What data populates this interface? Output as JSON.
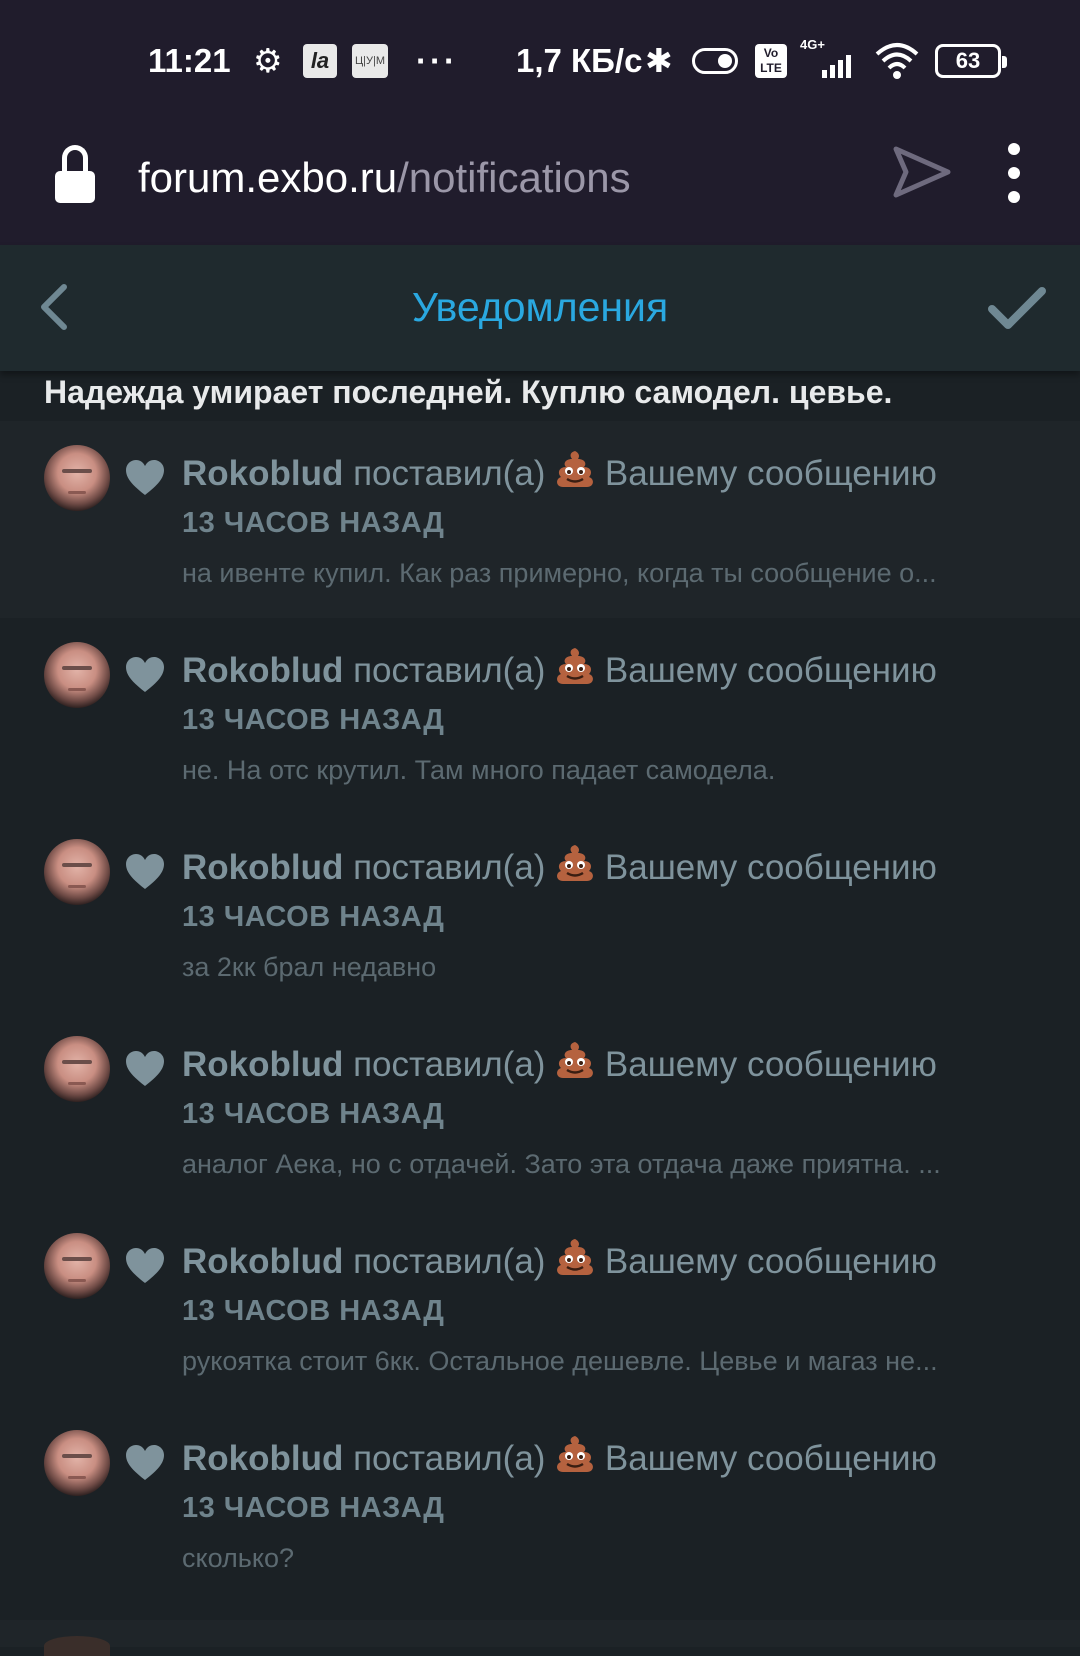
{
  "status_bar": {
    "time": "11:21",
    "app_icon_1": "la",
    "app_icon_2": "Ц|У|М",
    "more": "···",
    "network_speed": "1,7 КБ/с",
    "volte": "Vo LTE",
    "network_type": "4G+",
    "battery": "63",
    "icons": [
      "gear-icon",
      "bluetooth-icon",
      "toggle-icon",
      "signal-icon",
      "wifi-icon",
      "battery-icon"
    ]
  },
  "browser": {
    "url_host": "forum.exbo.ru",
    "url_path": "/notifications",
    "icons": [
      "lock-icon",
      "send-icon",
      "more-vert-icon"
    ]
  },
  "header": {
    "title": "Уведомления",
    "accent_color": "#2aa8e0",
    "icons": [
      "back-chevron-icon",
      "check-icon"
    ]
  },
  "group": {
    "title": "Надежда умирает последней. Куплю самодел. цевье."
  },
  "notifications": [
    {
      "user": "Rokoblud",
      "action": " поставил(а) ",
      "target": " Вашему сообщению",
      "time": "13 ЧАСОВ НАЗАД",
      "excerpt": "на ивенте купил. Как раз примерно, когда ты сообщение о..."
    },
    {
      "user": "Rokoblud",
      "action": " поставил(а) ",
      "target": " Вашему сообщению",
      "time": "13 ЧАСОВ НАЗАД",
      "excerpt": "не. На отс крутил. Там много падает самодела."
    },
    {
      "user": "Rokoblud",
      "action": " поставил(а) ",
      "target": " Вашему сообщению",
      "time": "13 ЧАСОВ НАЗАД",
      "excerpt": "за 2кк брал недавно"
    },
    {
      "user": "Rokoblud",
      "action": " поставил(а) ",
      "target": " Вашему сообщению",
      "time": "13 ЧАСОВ НАЗАД",
      "excerpt": "аналог Аека, но с отдачей. Зато эта отдача даже приятна. ..."
    },
    {
      "user": "Rokoblud",
      "action": " поставил(а) ",
      "target": " Вашему сообщению",
      "time": "13 ЧАСОВ НАЗАД",
      "excerpt": "рукоятка стоит 6кк. Остальное дешевле. Цевье и магаз не..."
    },
    {
      "user": "Rokoblud",
      "action": " поставил(а) ",
      "target": " Вашему сообщению",
      "time": "13 ЧАСОВ НАЗАД",
      "excerpt": "сколько?"
    }
  ]
}
